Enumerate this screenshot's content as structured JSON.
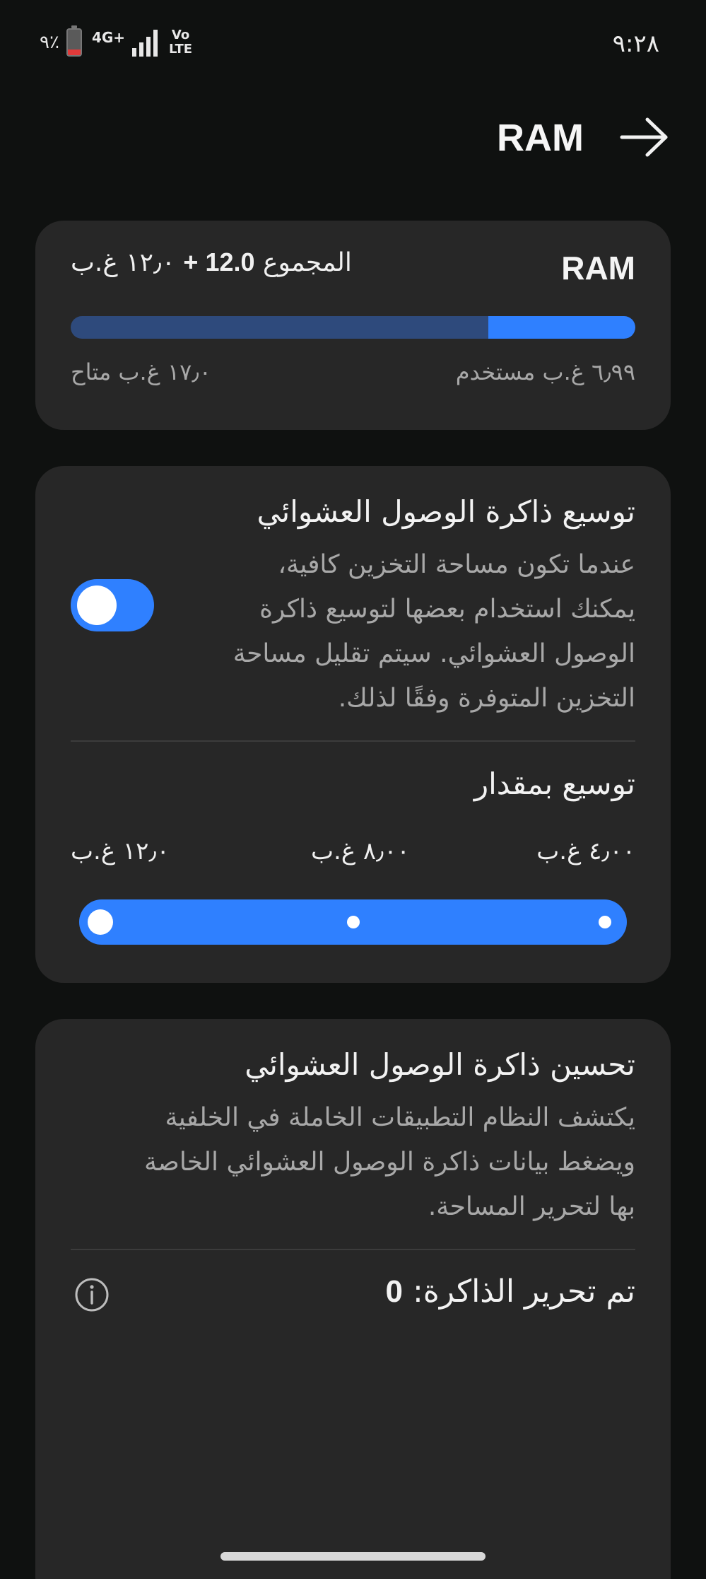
{
  "status_bar": {
    "time": "٩:٢٨",
    "battery_percent": "٪٩",
    "network_type": "4G+",
    "volte_top": "Vo",
    "volte_bottom": "LTE"
  },
  "header": {
    "title": "RAM",
    "back_icon": "arrow-right-icon"
  },
  "ram_card": {
    "title": "RAM",
    "total_label": "المجموع",
    "total_value": "12.0 +",
    "total_extra": "١٢٫٠ غ.ب",
    "used_text": "٦٫٩٩ غ.ب مستخدم",
    "available_text": "١٧٫٠ غ.ب متاح",
    "used_fraction": 0.26
  },
  "ram_plus_card": {
    "title": "توسيع ذاكرة الوصول العشوائي",
    "description_lines": [
      "عندما تكون مساحة التخزين كافية،",
      "يمكنك استخدام بعضها لتوسيع ذاكرة",
      "الوصول العشوائي. سيتم تقليل مساحة",
      "التخزين المتوفرة وفقًا لذلك."
    ],
    "toggle_on": true,
    "expand_title": "توسيع بمقدار",
    "scale_labels": [
      "٤٫٠٠ غ.ب",
      "٨٫٠٠ غ.ب",
      "١٢٫٠"
    ],
    "scale_suffix_left": "غ.ب",
    "selected_option": "١٢٫٠ غ.ب"
  },
  "optimize_card": {
    "title": "تحسين ذاكرة الوصول العشوائي",
    "description_lines": [
      "يكتشف النظام التطبيقات الخاملة في الخلفية",
      "ويضغط بيانات ذاكرة الوصول العشوائي الخاصة",
      "بها لتحرير المساحة."
    ],
    "freed_label": "تم تحرير الذاكرة:",
    "freed_value": "0",
    "info_icon": "info-icon"
  },
  "colors": {
    "background": "#0f1110",
    "card": "#272727",
    "accent": "#2f80ff",
    "bar_track": "#2e4a7c",
    "secondary_text": "#a8a8a8"
  }
}
